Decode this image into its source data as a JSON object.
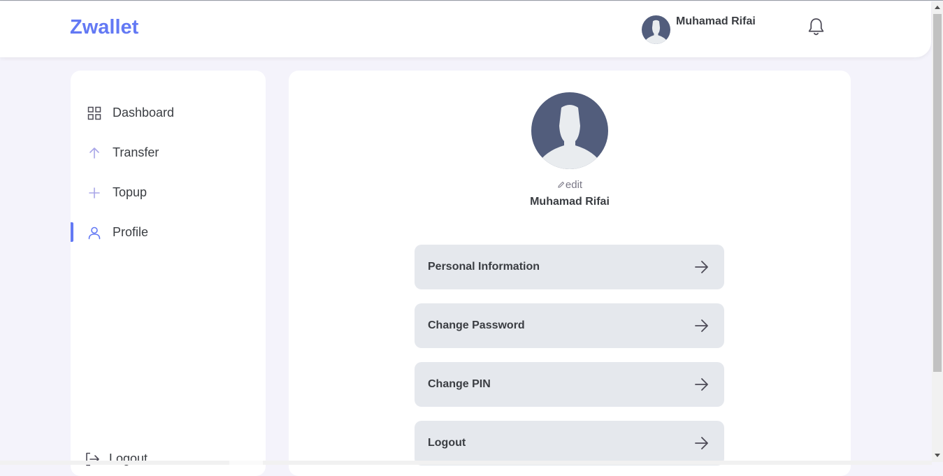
{
  "app": {
    "logo": "Zwallet"
  },
  "header": {
    "user_name": "Muhamad Rifai",
    "notification_icon": "bell-icon"
  },
  "sidebar": {
    "items": [
      {
        "label": "Dashboard",
        "icon": "grid-icon",
        "active": false
      },
      {
        "label": "Transfer",
        "icon": "arrow-up-icon",
        "active": false
      },
      {
        "label": "Topup",
        "icon": "plus-icon",
        "active": false
      },
      {
        "label": "Profile",
        "icon": "user-icon",
        "active": true
      }
    ],
    "logout": {
      "label": "Logout",
      "icon": "logout-icon"
    }
  },
  "profile": {
    "edit_label": "edit",
    "name": "Muhamad Rifai",
    "menu": [
      {
        "label": "Personal Information"
      },
      {
        "label": "Change Password"
      },
      {
        "label": "Change PIN"
      },
      {
        "label": "Logout"
      }
    ]
  },
  "colors": {
    "accent": "#6379f4",
    "background": "#f4f3fb",
    "card": "#ffffff",
    "menu_button": "#e5e8ed",
    "avatar": "#525d7c"
  }
}
